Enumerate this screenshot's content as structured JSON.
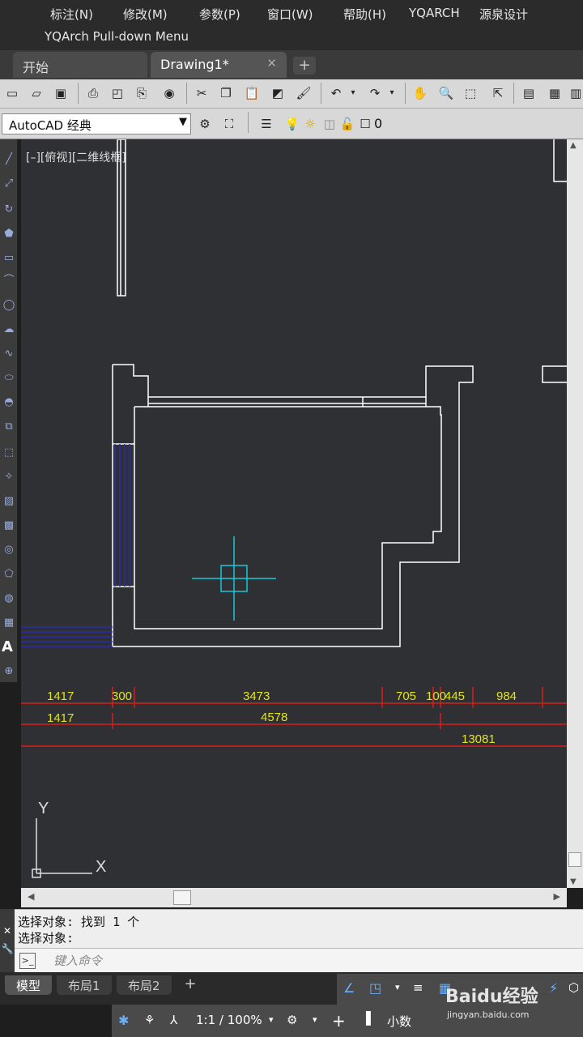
{
  "menu": {
    "items": [
      "标注(N)",
      "修改(M)",
      "参数(P)",
      "窗口(W)",
      "帮助(H)",
      "YQARCH",
      "源泉设计"
    ],
    "pulldown": "YQArch Pull-down Menu"
  },
  "tabs": {
    "items": [
      {
        "label": "开始"
      },
      {
        "label": "Drawing1*"
      }
    ],
    "close_glyph": "✕",
    "new_glyph": "+"
  },
  "toolbar2": {
    "workspace": "AutoCAD 经典",
    "layer": "0"
  },
  "drawing": {
    "viewport_label": "[–][俯视][二维线框]",
    "dimensions": [
      {
        "text": "1417"
      },
      {
        "text": "300"
      },
      {
        "text": "3473"
      },
      {
        "text": "705"
      },
      {
        "text": "100"
      },
      {
        "text": "445"
      },
      {
        "text": "984"
      },
      {
        "text": "1417"
      },
      {
        "text": "4578"
      },
      {
        "text": "13081"
      }
    ],
    "ucs": {
      "x_label": "X",
      "y_label": "Y"
    },
    "colors": {
      "walls": "#ffffff",
      "dimension_lines": "#d81e1e",
      "dimension_text": "#e3e31a",
      "window_hatch": "#2a2ab0",
      "cursor": "#18c8d8"
    }
  },
  "command": {
    "history": [
      "选择对象: 找到 1 个",
      "选择对象:"
    ],
    "placeholder": "键入命令",
    "side_glyphs": [
      "✕",
      "🔧"
    ]
  },
  "layout_tabs": [
    {
      "label": "模型"
    },
    {
      "label": "布局1"
    },
    {
      "label": "布局2"
    }
  ],
  "layout_add": "+",
  "status": {
    "scale": "1:1 / 100%",
    "units": "小数"
  },
  "watermark": {
    "brand": "Baidu经验",
    "url": "jingyan.baidu.com"
  }
}
